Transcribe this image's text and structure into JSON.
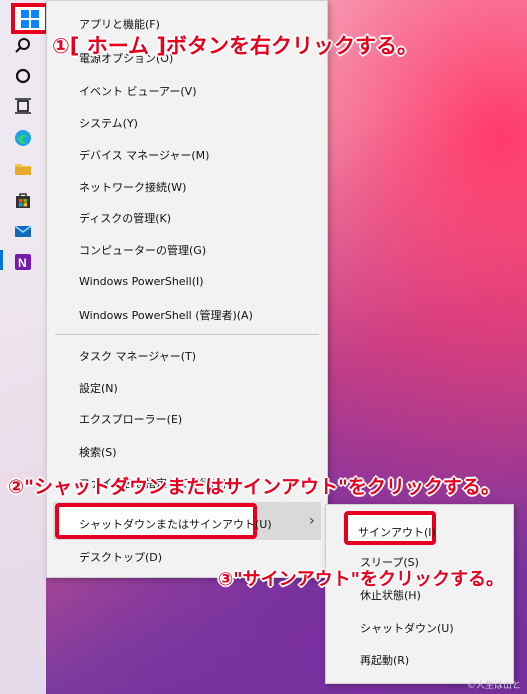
{
  "taskbar": {
    "icons": [
      "windows-start-icon",
      "search-icon",
      "cortana-icon",
      "task-view-icon",
      "edge-icon",
      "file-explorer-icon",
      "store-icon",
      "mail-icon",
      "onenote-icon"
    ]
  },
  "menu": {
    "items": [
      "アプリと機能(F)",
      "電源オプション(O)",
      "イベント ビューアー(V)",
      "システム(Y)",
      "デバイス マネージャー(M)",
      "ネットワーク接続(W)",
      "ディスクの管理(K)",
      "コンピューターの管理(G)",
      "Windows PowerShell(I)",
      "Windows PowerShell (管理者)(A)",
      "タスク マネージャー(T)",
      "設定(N)",
      "エクスプローラー(E)",
      "検索(S)",
      "ファイル名を指定して実行(R)",
      "シャットダウンまたはサインアウト(U)",
      "デスクトップ(D)"
    ]
  },
  "submenu": {
    "items": [
      "サインアウト(I)",
      "スリープ(S)",
      "休止状態(H)",
      "シャットダウン(U)",
      "再起動(R)"
    ]
  },
  "annotations": {
    "step1": "①[ ホーム ]ボタンを右クリックする。",
    "step2": "②\"シャットダウンまたはサインアウト\"をクリックする。",
    "step3": "③\"サインアウト\"をクリックする。"
  },
  "copyright": "©人生は山と",
  "colors": {
    "accent_red": "#e6001e",
    "menu_bg": "#f2f2f2",
    "highlight": "#d9d9d9"
  }
}
